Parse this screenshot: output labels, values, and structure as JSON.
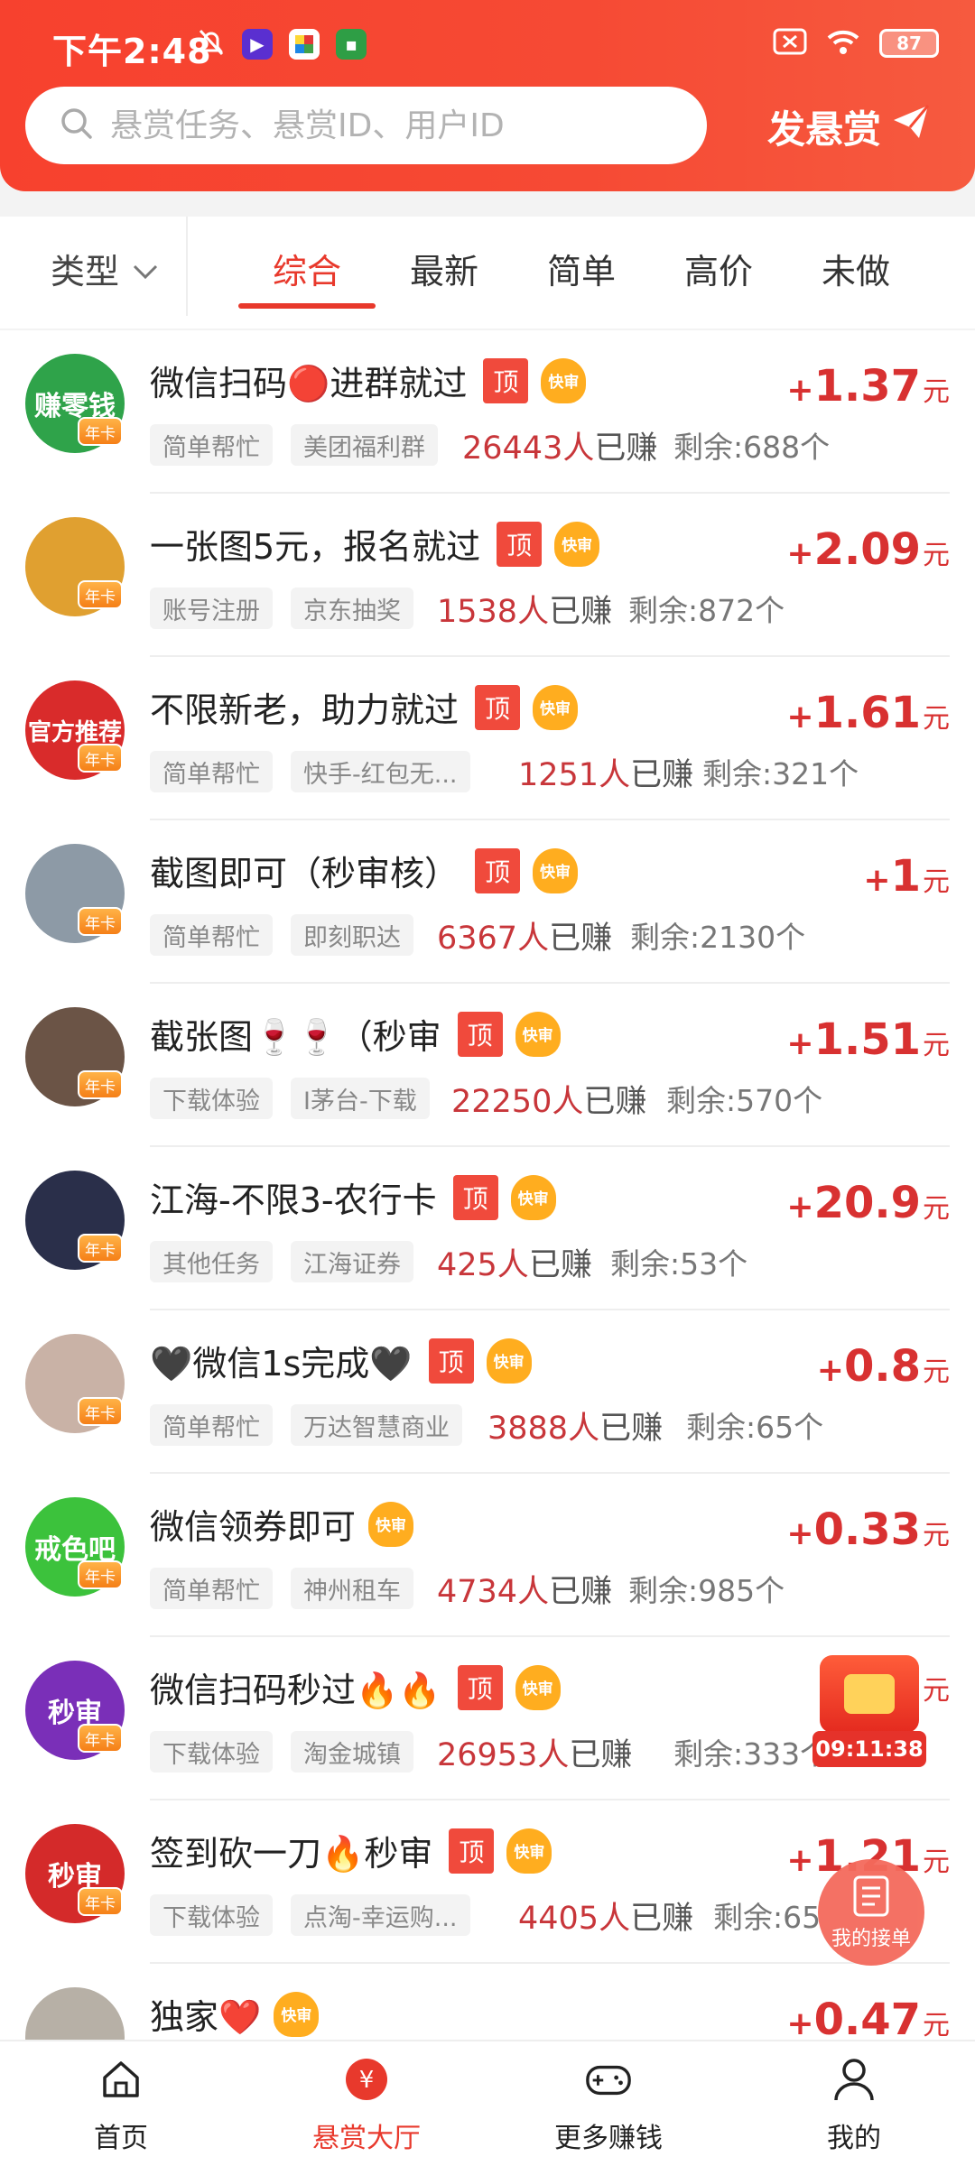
{
  "status_bar": {
    "time": "下午2:48",
    "battery": "87"
  },
  "search": {
    "placeholder": "悬赏任务、悬赏ID、用户ID"
  },
  "post_button": {
    "label": "发悬赏"
  },
  "filters": {
    "type_label": "类型",
    "tabs": [
      "综合",
      "最新",
      "简单",
      "高价",
      "未做"
    ],
    "active_tab": "综合"
  },
  "tag_labels": {
    "top": "顶",
    "fast": "快审",
    "annual": "年卡"
  },
  "tasks": [
    {
      "title": "微信扫码🔴进群就过",
      "top": true,
      "fast": true,
      "category": "简单帮忙",
      "merchant": "美团福利群",
      "earned_num": "26443人",
      "earned_suffix": "已赚",
      "remaining": "剩余:688个",
      "plus": "+",
      "amount": "1.37",
      "unit": "元",
      "avatar_text": "赚零钱",
      "avatar_color": "#2fa34a"
    },
    {
      "title": "一张图5元，报名就过",
      "top": true,
      "fast": true,
      "category": "账号注册",
      "merchant": "京东抽奖",
      "earned_num": "1538人",
      "earned_suffix": "已赚",
      "remaining": "剩余:872个",
      "plus": "+",
      "amount": "2.09",
      "unit": "元",
      "avatar_text": "",
      "avatar_color": "#e0a030"
    },
    {
      "title": "不限新老，助力就过",
      "top": true,
      "fast": true,
      "category": "简单帮忙",
      "merchant": "快手-红包无...",
      "earned_num": "1251人",
      "earned_suffix": "已赚",
      "remaining": "剩余:321个",
      "plus": "+",
      "amount": "1.61",
      "unit": "元",
      "avatar_text": "官方推荐",
      "avatar_color": "#d92b2b"
    },
    {
      "title": "截图即可（秒审核）",
      "top": true,
      "fast": true,
      "category": "简单帮忙",
      "merchant": "即刻职达",
      "earned_num": "6367人",
      "earned_suffix": "已赚",
      "remaining": "剩余:2130个",
      "plus": "+",
      "amount": "1",
      "unit": "元",
      "avatar_text": "",
      "avatar_color": "#8d9aa6"
    },
    {
      "title": "截张图🍷🍷（秒审",
      "top": true,
      "fast": true,
      "category": "下载体验",
      "merchant": "I茅台-下载",
      "earned_num": "22250人",
      "earned_suffix": "已赚",
      "remaining": "剩余:570个",
      "plus": "+",
      "amount": "1.51",
      "unit": "元",
      "avatar_text": "",
      "avatar_color": "#6b5446"
    },
    {
      "title": "江海-不限3-农行卡",
      "top": true,
      "fast": true,
      "category": "其他任务",
      "merchant": "江海证券",
      "earned_num": "425人",
      "earned_suffix": "已赚",
      "remaining": "剩余:53个",
      "plus": "+",
      "amount": "20.9",
      "unit": "元",
      "avatar_text": "",
      "avatar_color": "#2a2f4a"
    },
    {
      "title": "🖤微信1s完成🖤",
      "top": true,
      "fast": true,
      "category": "简单帮忙",
      "merchant": "万达智慧商业",
      "earned_num": "3888人",
      "earned_suffix": "已赚",
      "remaining": "剩余:65个",
      "plus": "+",
      "amount": "0.8",
      "unit": "元",
      "avatar_text": "",
      "avatar_color": "#c9b2a6"
    },
    {
      "title": "微信领券即可",
      "top": false,
      "fast": true,
      "category": "简单帮忙",
      "merchant": "神州租车",
      "earned_num": "4734人",
      "earned_suffix": "已赚",
      "remaining": "剩余:985个",
      "plus": "+",
      "amount": "0.33",
      "unit": "元",
      "avatar_text": "戒色吧",
      "avatar_color": "#3cc23c"
    },
    {
      "title": "微信扫码秒过🔥🔥",
      "top": true,
      "fast": true,
      "category": "下载体验",
      "merchant": "淘金城镇",
      "earned_num": "26953人",
      "earned_suffix": "已赚",
      "remaining": "剩余:333个",
      "plus": "",
      "amount": "",
      "unit": "元",
      "avatar_text": "秒审",
      "avatar_color": "#7a2fb8"
    },
    {
      "title": "签到砍一刀🔥秒审",
      "top": true,
      "fast": true,
      "category": "下载体验",
      "merchant": "点淘-幸运购...",
      "earned_num": "4405人",
      "earned_suffix": "已赚",
      "remaining": "剩余:65",
      "plus": "+",
      "amount": "1.21",
      "unit": "元",
      "avatar_text": "秒审",
      "avatar_color": "#d42a2a"
    },
    {
      "title": "独家❤️",
      "top": false,
      "fast": true,
      "category": "",
      "merchant": "",
      "earned_num": "",
      "earned_suffix": "",
      "remaining": "",
      "plus": "+",
      "amount": "0.47",
      "unit": "元",
      "avatar_text": "",
      "avatar_color": "#b7b0a6"
    }
  ],
  "floating": {
    "countdown": "09:11:38",
    "my_orders_label": "我的接单"
  },
  "bottom_nav": [
    {
      "label": "首页",
      "icon": "home-icon"
    },
    {
      "label": "悬赏大厅",
      "icon": "yuan-icon"
    },
    {
      "label": "更多赚钱",
      "icon": "gamepad-icon"
    },
    {
      "label": "我的",
      "icon": "person-icon"
    }
  ],
  "colors": {
    "brand": "#f7412e",
    "price": "#d83131",
    "tag_top": "#f04a3c",
    "tag_fast": "#ffad1f"
  }
}
